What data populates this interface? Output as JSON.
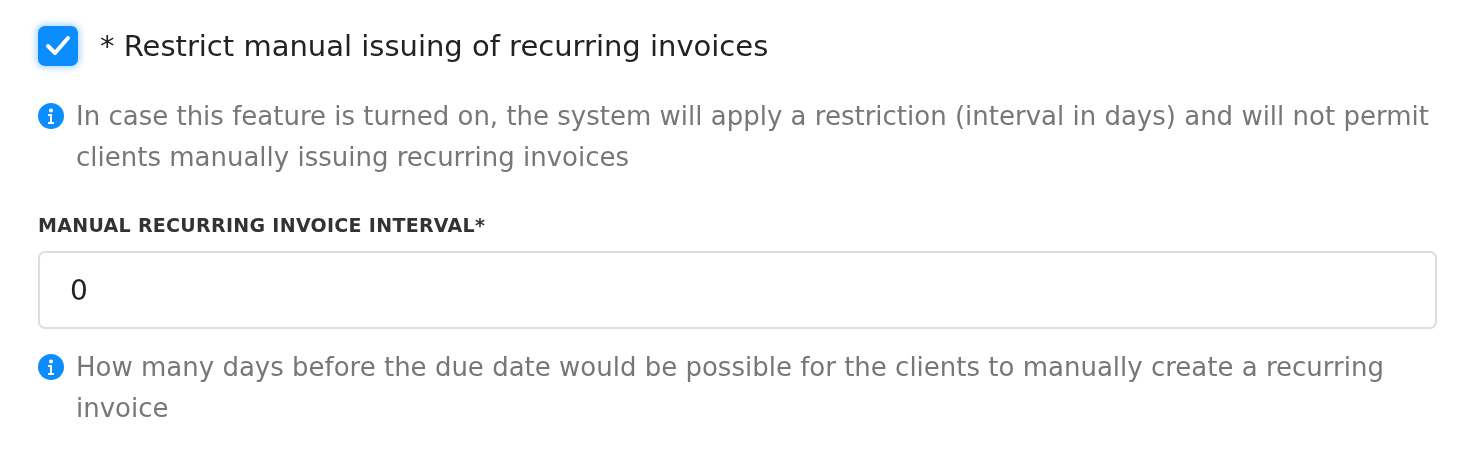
{
  "restrict_option": {
    "label": "* Restrict manual issuing of recurring invoices",
    "checked": true
  },
  "restrict_help": "In case this feature is turned on, the system will apply a restriction (interval in days) and will not permit clients manually issuing recurring invoices",
  "interval_field": {
    "label": "MANUAL RECURRING INVOICE INTERVAL*",
    "value": "0"
  },
  "interval_help": "How many days before the due date would be possible for the clients to manually create a recurring invoice"
}
